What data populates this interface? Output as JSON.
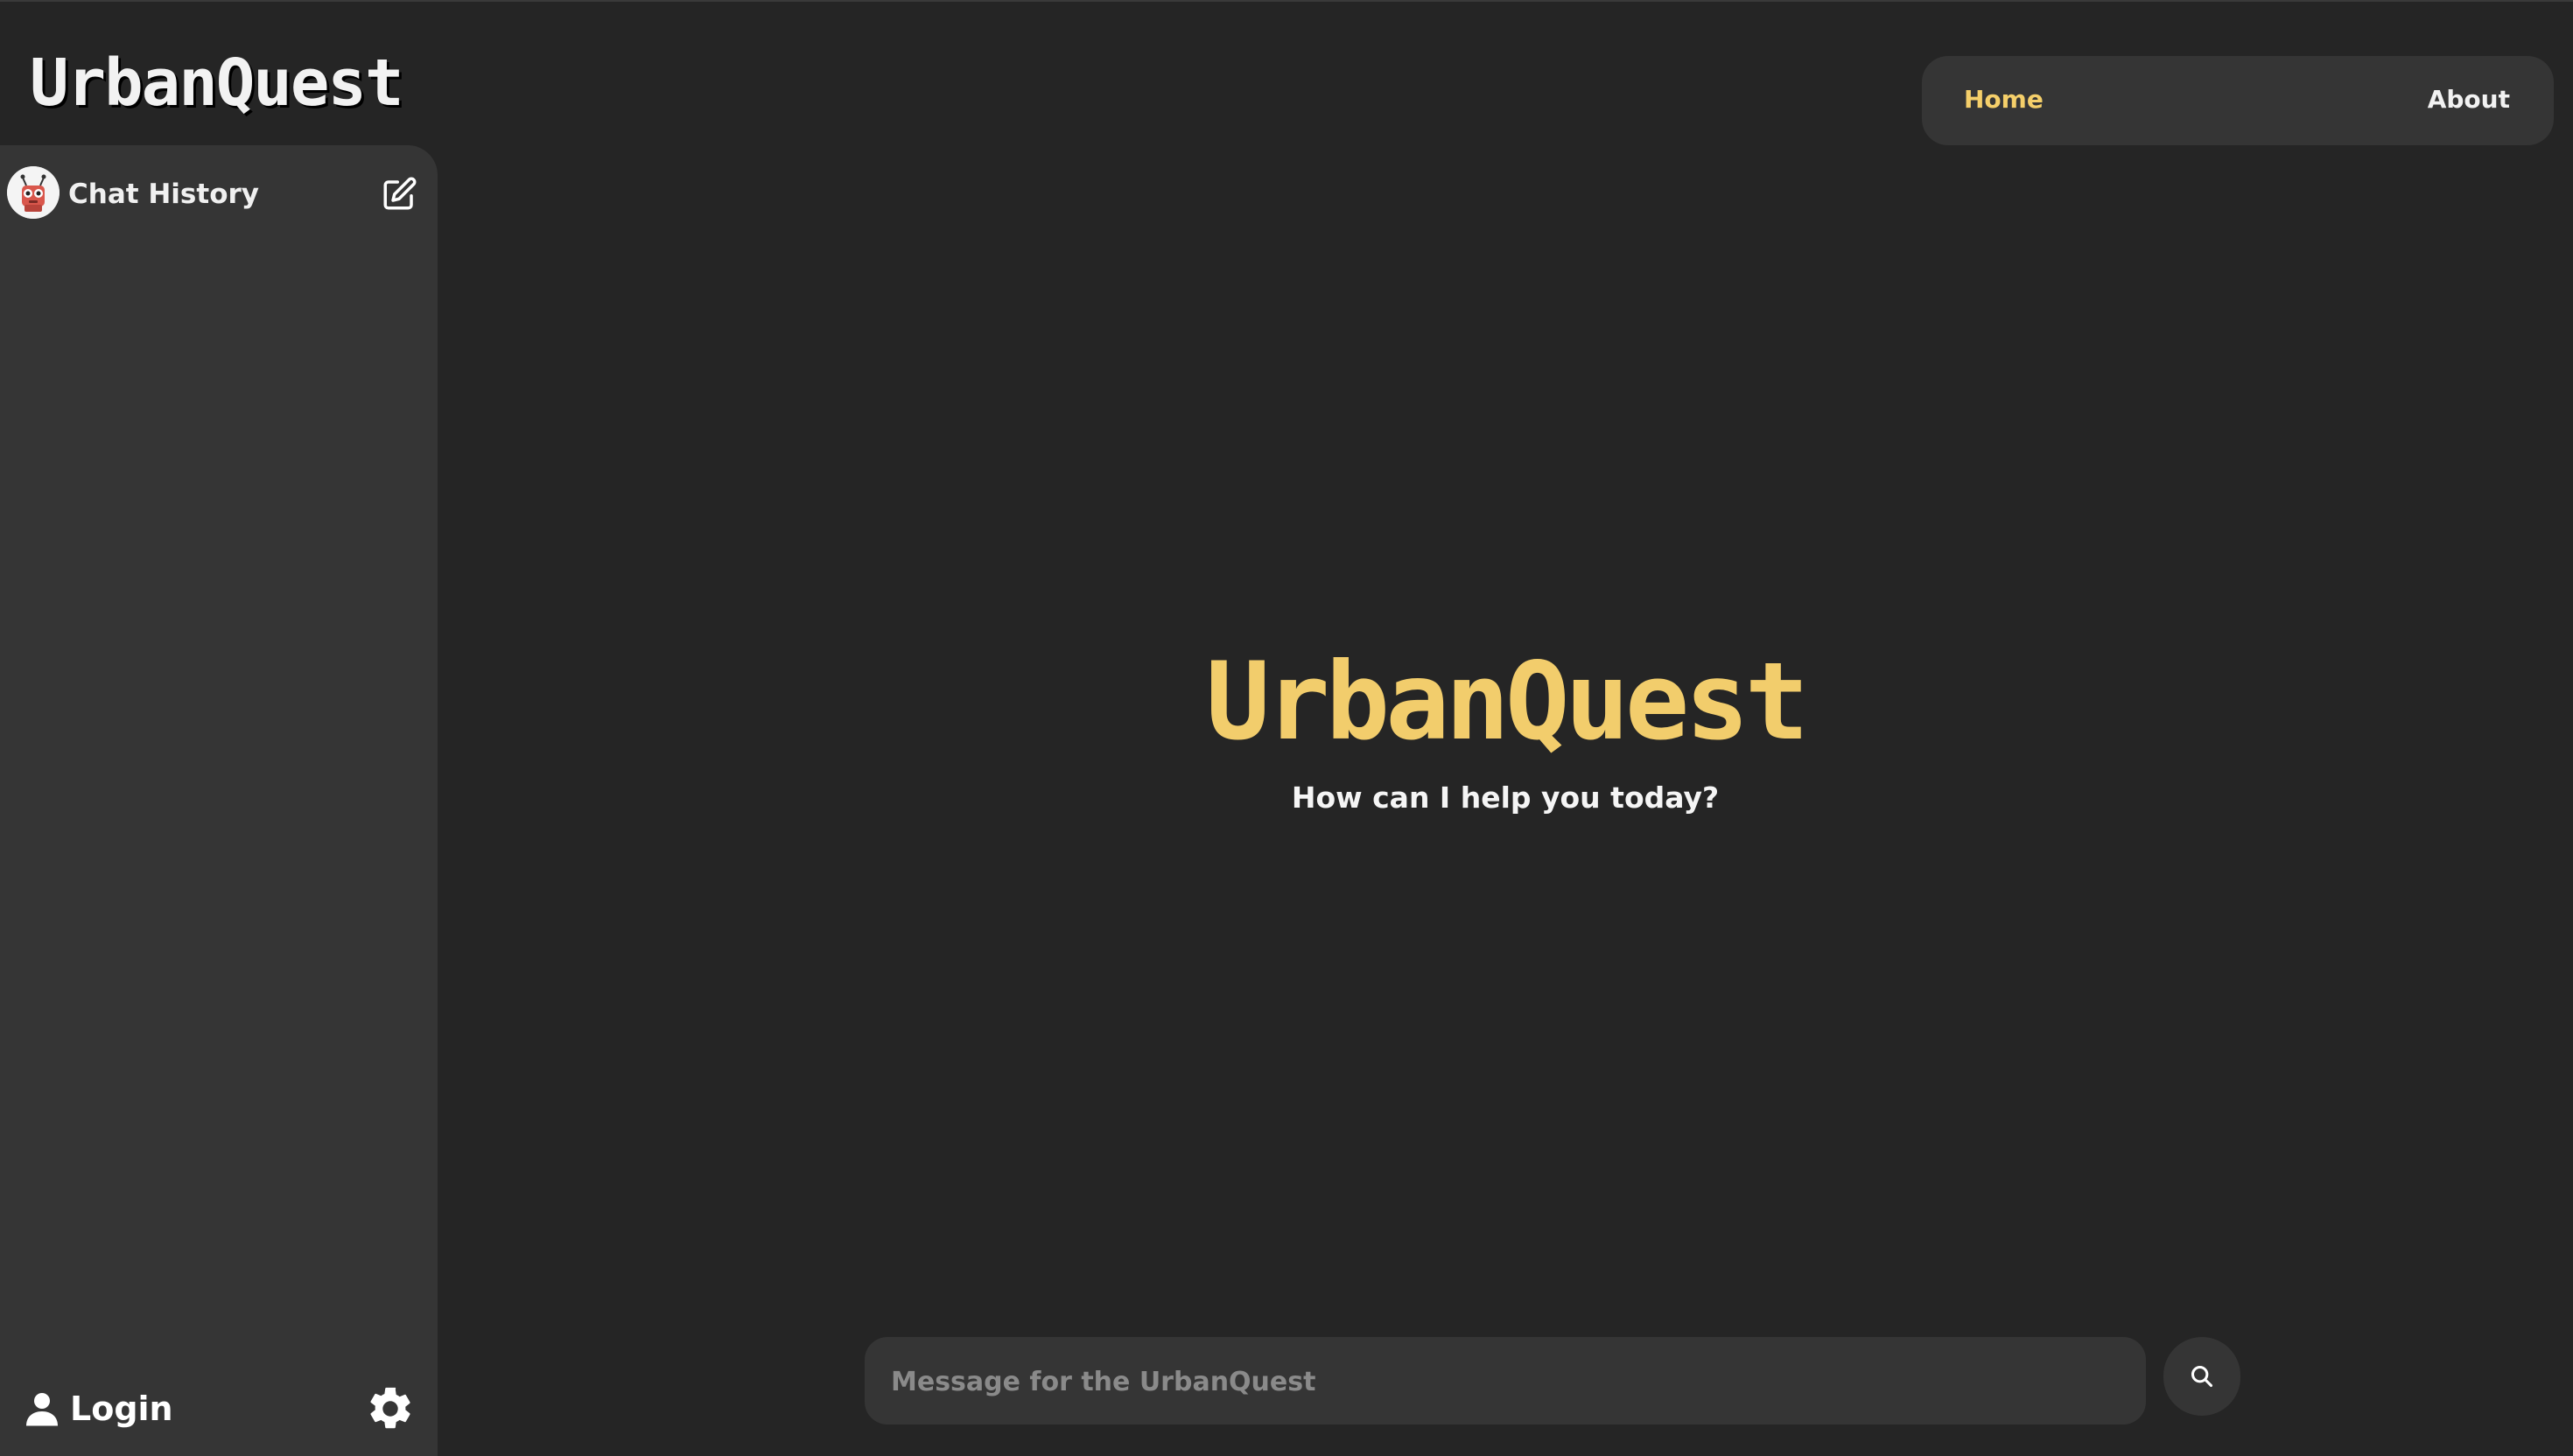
{
  "app": {
    "brand": "UrbanQuest"
  },
  "sidebar": {
    "header_label": "Chat History",
    "avatar_icon": "robot-avatar-icon",
    "new_chat_icon": "edit-icon",
    "footer": {
      "login_label": "Login",
      "login_icon": "user-icon",
      "settings_icon": "gear-icon"
    }
  },
  "nav": {
    "items": [
      {
        "label": "Home",
        "active": true
      },
      {
        "label": "About",
        "active": false
      }
    ],
    "active_color": "#f5cf6a"
  },
  "hero": {
    "title": "UrbanQuest",
    "subtitle": "How can I help you today?",
    "title_color": "#f2cd6c"
  },
  "composer": {
    "placeholder": "Message for the UrbanQuest",
    "value": "",
    "send_icon": "search-icon"
  },
  "theme": {
    "background": "#252525",
    "panel": "#353535"
  }
}
